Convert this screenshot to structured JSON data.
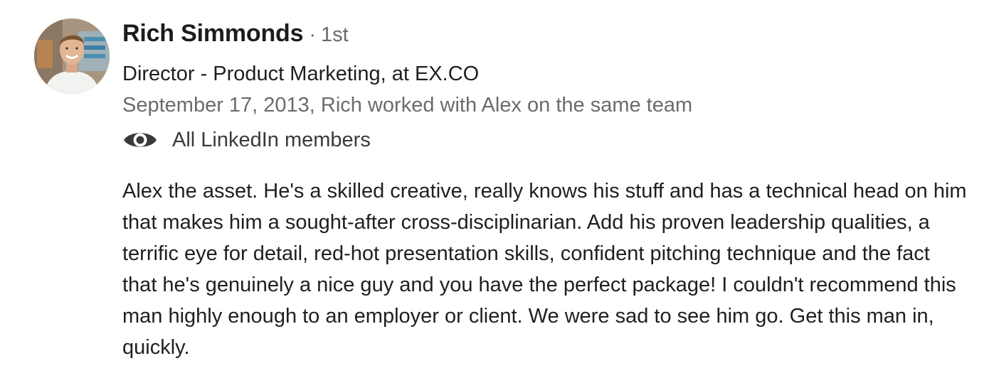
{
  "recommendation": {
    "author": {
      "name": "Rich Simmonds",
      "separator": "·",
      "connection_degree": "1st",
      "headline": "Director - Product Marketing, at EX.CO",
      "avatar_icon": "profile-photo"
    },
    "meta": "September 17, 2013, Rich worked with Alex on the same team",
    "visibility": {
      "icon": "eye-icon",
      "label": "All LinkedIn members"
    },
    "text": "Alex the asset. He's a skilled creative, really knows his stuff and has a technical head on him that makes him a sought-after cross-disciplinarian. Add his proven leadership qualities, a terrific eye for detail, red-hot presentation skills, confident pitching technique and the fact that he's genuinely a nice guy and you have the perfect package! I couldn't recommend this man highly enough to an employer or client. We were sad to see him go. Get this man in, quickly."
  },
  "colors": {
    "primary_text": "#1f1f1f",
    "secondary_text": "#6b6b6b",
    "background": "#ffffff"
  }
}
